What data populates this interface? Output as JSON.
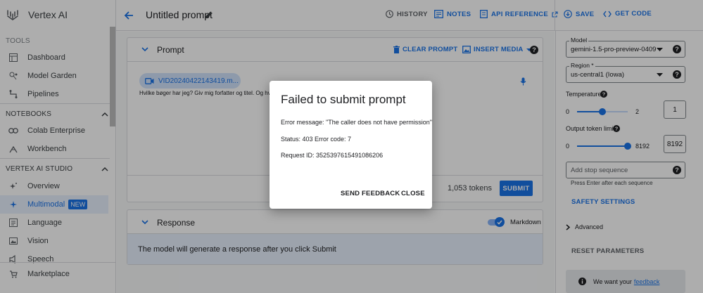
{
  "app": {
    "name": "Vertex AI"
  },
  "sidebar": {
    "tools_heading": "TOOLS",
    "tools": [
      {
        "label": "Dashboard",
        "icon": "dashboard-icon"
      },
      {
        "label": "Model Garden",
        "icon": "model-garden-icon"
      },
      {
        "label": "Pipelines",
        "icon": "pipelines-icon"
      }
    ],
    "notebooks_heading": "NOTEBOOKS",
    "notebooks": [
      {
        "label": "Colab Enterprise",
        "icon": "colab-icon"
      },
      {
        "label": "Workbench",
        "icon": "workbench-icon"
      }
    ],
    "studio_heading": "VERTEX AI STUDIO",
    "studio": [
      {
        "label": "Overview",
        "icon": "sparkle-icon"
      },
      {
        "label": "Multimodal",
        "icon": "multimodal-icon",
        "badge": "NEW",
        "active": true
      },
      {
        "label": "Language",
        "icon": "language-icon"
      },
      {
        "label": "Vision",
        "icon": "vision-icon"
      },
      {
        "label": "Speech",
        "icon": "speech-icon"
      }
    ],
    "footer": {
      "label": "Marketplace",
      "icon": "marketplace-icon"
    }
  },
  "topbar": {
    "title": "Untitled prompt",
    "history": "HISTORY",
    "notes": "NOTES",
    "api_reference": "API REFERENCE",
    "save": "SAVE",
    "get_code": "GET CODE"
  },
  "prompt": {
    "heading": "Prompt",
    "clear": "CLEAR PROMPT",
    "insert_media": "INSERT MEDIA",
    "file_chip": "VID20240422143419.m...",
    "text": "Hvilke bøger har jeg? Giv mig forfatter og titel. Og hvor",
    "tokens": "1,053 tokens",
    "submit": "SUBMIT"
  },
  "response": {
    "heading": "Response",
    "markdown": "Markdown",
    "placeholder": "The model will generate a response after you click Submit"
  },
  "settings": {
    "model_label": "Model",
    "model_value": "gemini-1.5-pro-preview-0409",
    "region_label": "Region *",
    "region_value": "us-central1 (Iowa)",
    "temperature_label": "Temperature",
    "temperature_min": "0",
    "temperature_max": "2",
    "temperature_value": "1",
    "temperature_fraction": 0.5,
    "output_label": "Output token limit",
    "output_min": "0",
    "output_max": "8192",
    "output_value": "8192",
    "output_fraction": 1.0,
    "stop_placeholder": "Add stop sequence",
    "stop_hint": "Press Enter after each sequence",
    "safety": "SAFETY SETTINGS",
    "advanced": "Advanced",
    "reset": "RESET PARAMETERS",
    "feedback_prefix": "We want your",
    "feedback_link": "feedback"
  },
  "dialog": {
    "title": "Failed to submit prompt",
    "error_message": "Error message: \"The caller does not have permission\"",
    "status": "Status: 403 Error code: 7",
    "request_id": "Request ID: 3525397615491086206",
    "send_feedback": "SEND FEEDBACK",
    "close": "CLOSE"
  },
  "colors": {
    "accent": "#1a73e8",
    "scrim": "#000000"
  }
}
